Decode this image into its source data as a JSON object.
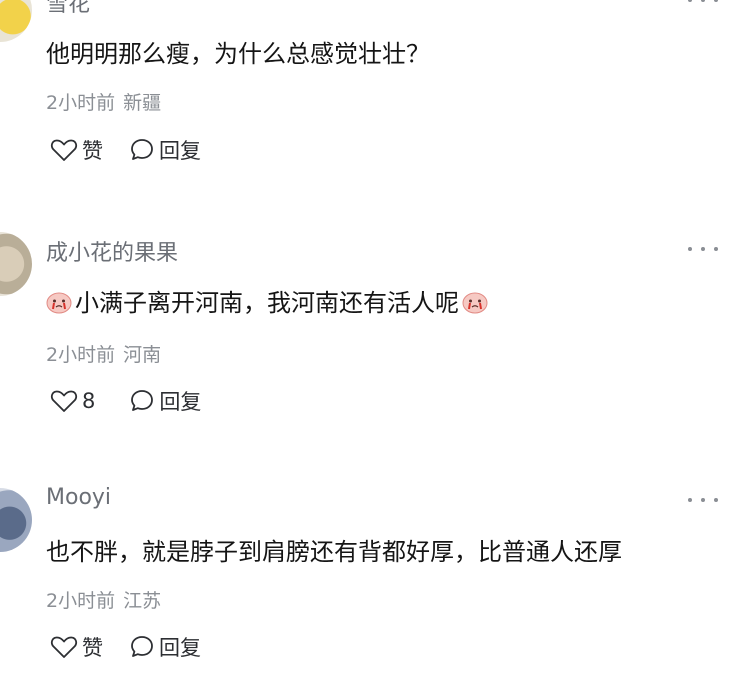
{
  "comments": [
    {
      "username": "雪花",
      "text": "他明明那么瘦，为什么总感觉壮壮？",
      "time": "2小时前",
      "location": "新疆",
      "like_label": "赞",
      "reply_label": "回复"
    },
    {
      "username": "成小花的果果",
      "text": "小满子离开河南，我河南还有活人呢",
      "emoji": "crying-face-emoji",
      "time": "2小时前",
      "location": "河南",
      "like_label": "8",
      "reply_label": "回复"
    },
    {
      "username": "Mooyi",
      "text": "也不胖，就是脖子到肩膀还有背都好厚，比普通人还厚",
      "time": "2小时前",
      "location": "江苏",
      "like_label": "赞",
      "reply_label": "回复"
    }
  ],
  "icons": {
    "like": "heart-outline-icon",
    "reply": "speech-bubble-icon",
    "more": "more-dots-icon"
  }
}
